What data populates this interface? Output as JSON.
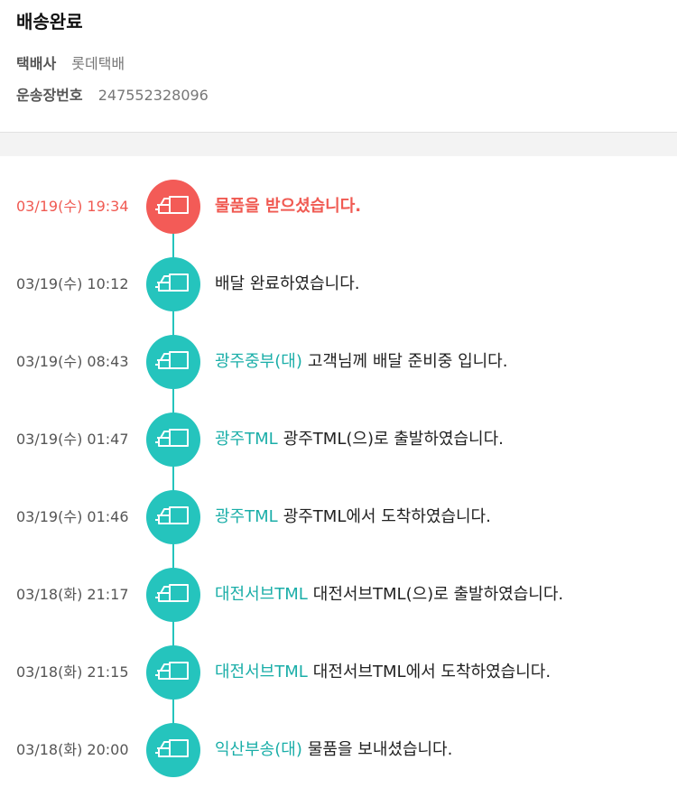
{
  "header": {
    "status_title": "배송완료",
    "carrier_label": "택배사",
    "carrier_value": "롯데택배",
    "tracking_label": "운송장번호",
    "tracking_value": "247552328096"
  },
  "colors": {
    "accent_teal": "#25c4bd",
    "accent_red": "#f35b57"
  },
  "events": [
    {
      "time": "03/19(수) 19:34",
      "location": "",
      "message": "물품을 받으셨습니다.",
      "icon": "truck-icon"
    },
    {
      "time": "03/19(수) 10:12",
      "location": "",
      "message": "배달 완료하였습니다.",
      "icon": "truck-icon"
    },
    {
      "time": "03/19(수) 08:43",
      "location": "광주중부(대)",
      "message": "고객님께 배달 준비중 입니다.",
      "icon": "truck-icon"
    },
    {
      "time": "03/19(수) 01:47",
      "location": "광주TML",
      "message": "광주TML(으)로 출발하였습니다.",
      "icon": "truck-icon"
    },
    {
      "time": "03/19(수) 01:46",
      "location": "광주TML",
      "message": "광주TML에서 도착하였습니다.",
      "icon": "truck-icon"
    },
    {
      "time": "03/18(화) 21:17",
      "location": "대전서브TML",
      "message": "대전서브TML(으)로 출발하였습니다.",
      "icon": "truck-icon"
    },
    {
      "time": "03/18(화) 21:15",
      "location": "대전서브TML",
      "message": "대전서브TML에서 도착하였습니다.",
      "icon": "truck-icon"
    },
    {
      "time": "03/18(화) 20:00",
      "location": "익산부송(대)",
      "message": "물품을 보내셨습니다.",
      "icon": "truck-icon"
    }
  ]
}
